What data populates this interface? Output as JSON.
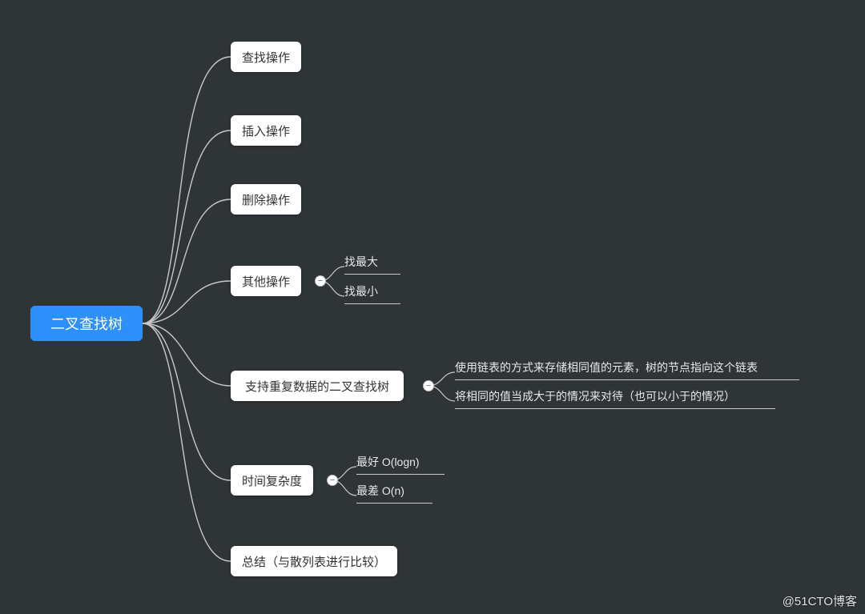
{
  "root": {
    "label": "二叉查找树"
  },
  "children": [
    {
      "id": "search",
      "label": "查找操作"
    },
    {
      "id": "insert",
      "label": "插入操作"
    },
    {
      "id": "delete",
      "label": "删除操作"
    },
    {
      "id": "other",
      "label": "其他操作",
      "children": [
        {
          "label": "找最大"
        },
        {
          "label": "找最小"
        }
      ]
    },
    {
      "id": "duplicate",
      "label": "支持重复数据的二叉查找树",
      "children": [
        {
          "label": "使用链表的方式来存储相同值的元素，树的节点指向这个链表"
        },
        {
          "label": "将相同的值当成大于的情况来对待（也可以小于的情况）"
        }
      ]
    },
    {
      "id": "time",
      "label": "时间复杂度",
      "children": [
        {
          "label": "最好 O(logn)"
        },
        {
          "label": "最差 O(n)"
        }
      ]
    },
    {
      "id": "summary",
      "label": "总结（与散列表进行比较）"
    }
  ],
  "watermark": "@51CTO博客",
  "chart_data": {
    "type": "tree",
    "title": "二叉查找树",
    "nodes": [
      {
        "id": "root",
        "label": "二叉查找树",
        "parent": null
      },
      {
        "id": "n1",
        "label": "查找操作",
        "parent": "root"
      },
      {
        "id": "n2",
        "label": "插入操作",
        "parent": "root"
      },
      {
        "id": "n3",
        "label": "删除操作",
        "parent": "root"
      },
      {
        "id": "n4",
        "label": "其他操作",
        "parent": "root"
      },
      {
        "id": "n4a",
        "label": "找最大",
        "parent": "n4"
      },
      {
        "id": "n4b",
        "label": "找最小",
        "parent": "n4"
      },
      {
        "id": "n5",
        "label": "支持重复数据的二叉查找树",
        "parent": "root"
      },
      {
        "id": "n5a",
        "label": "使用链表的方式来存储相同值的元素，树的节点指向这个链表",
        "parent": "n5"
      },
      {
        "id": "n5b",
        "label": "将相同的值当成大于的情况来对待（也可以小于的情况）",
        "parent": "n5"
      },
      {
        "id": "n6",
        "label": "时间复杂度",
        "parent": "root"
      },
      {
        "id": "n6a",
        "label": "最好 O(logn)",
        "parent": "n6"
      },
      {
        "id": "n6b",
        "label": "最差 O(n)",
        "parent": "n6"
      },
      {
        "id": "n7",
        "label": "总结（与散列表进行比较）",
        "parent": "root"
      }
    ]
  }
}
